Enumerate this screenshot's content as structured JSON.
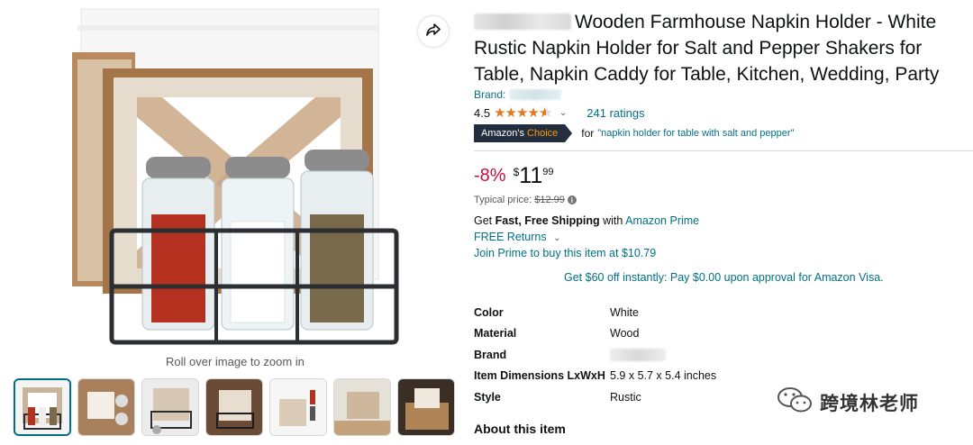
{
  "gallery": {
    "zoom_hint": "Roll over image to zoom in",
    "thumbnail_count": 7
  },
  "product": {
    "title": "Wooden Farmhouse Napkin Holder - White Rustic Napkin Holder for Salt and Pepper Shakers for Table, Napkin Caddy for Table, Kitchen, Wedding, Party",
    "brand_label": "Brand:",
    "rating_value": "4.5",
    "stars": 4.5,
    "ratings_count": "241 ratings",
    "badge": {
      "prefix": "Amazon's",
      "choice": "Choice",
      "for_text": "for",
      "query": "\"napkin holder for table with salt and pepper\""
    }
  },
  "price": {
    "discount": "-8%",
    "currency": "$",
    "whole": "11",
    "fraction": "99",
    "typical_label": "Typical price:",
    "typical_value": "$12.99"
  },
  "shipping": {
    "get": "Get",
    "bold": "Fast, Free Shipping",
    "with": "with",
    "prime_link": "Amazon Prime",
    "returns": "FREE Returns",
    "join_prime": "Join Prime to buy this item at $10.79",
    "visa_offer": "Get $60 off instantly: Pay $0.00 upon approval for Amazon Visa."
  },
  "specs": [
    {
      "key": "Color",
      "value": "White"
    },
    {
      "key": "Material",
      "value": "Wood"
    },
    {
      "key": "Brand",
      "value": ""
    },
    {
      "key": "Item Dimensions LxWxH",
      "value": "5.9 x 5.7 x 5.4 inches"
    },
    {
      "key": "Style",
      "value": "Rustic"
    }
  ],
  "about_heading": "About this item",
  "watermark": "跨境林老师",
  "colors": {
    "link": "#007185",
    "discount": "#CC0C39",
    "star": "#DE7921",
    "badge_bg": "#232F3E",
    "badge_accent": "#FF9900"
  }
}
